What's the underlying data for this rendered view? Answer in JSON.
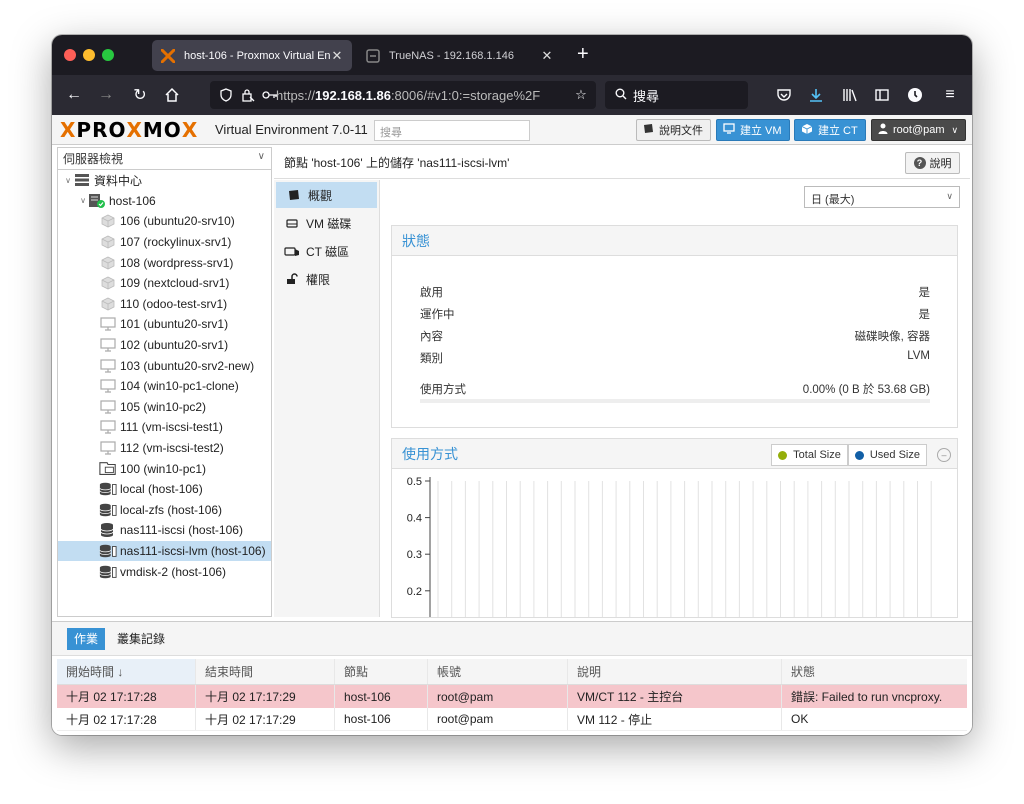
{
  "browser": {
    "tabs": [
      {
        "title": "host-106 - Proxmox Virtual Envi",
        "active": true
      },
      {
        "title": "TrueNAS - 192.168.1.146",
        "active": false
      }
    ],
    "url_prefix": "https://",
    "url_host": "192.168.1.86",
    "url_rest": ":8006/#v1:0:=storage%2F",
    "search_placeholder": "搜尋"
  },
  "header": {
    "logo_pre": "PRO",
    "logo_x": "X",
    "logo_post": "MO",
    "logo_x2": "X",
    "version": "Virtual Environment 7.0-11",
    "search_placeholder": "搜尋",
    "doc_label": "說明文件",
    "create_vm_label": "建立 VM",
    "create_ct_label": "建立 CT",
    "user_label": "root@pam"
  },
  "tree": {
    "view_label": "伺服器檢視",
    "items": [
      {
        "label": "資料中心",
        "level": 0,
        "type": "datacenter",
        "expander": "∨"
      },
      {
        "label": "host-106",
        "level": 1,
        "type": "node",
        "expander": "∨"
      },
      {
        "label": "106 (ubuntu20-srv10)",
        "level": 2,
        "type": "ct"
      },
      {
        "label": "107 (rockylinux-srv1)",
        "level": 2,
        "type": "ct"
      },
      {
        "label": "108 (wordpress-srv1)",
        "level": 2,
        "type": "ct"
      },
      {
        "label": "109 (nextcloud-srv1)",
        "level": 2,
        "type": "ct"
      },
      {
        "label": "110 (odoo-test-srv1)",
        "level": 2,
        "type": "ct"
      },
      {
        "label": "101 (ubuntu20-srv1)",
        "level": 2,
        "type": "vm"
      },
      {
        "label": "102 (ubuntu20-srv1)",
        "level": 2,
        "type": "vm"
      },
      {
        "label": "103 (ubuntu20-srv2-new)",
        "level": 2,
        "type": "vm"
      },
      {
        "label": "104 (win10-pc1-clone)",
        "level": 2,
        "type": "vm"
      },
      {
        "label": "105 (win10-pc2)",
        "level": 2,
        "type": "vm"
      },
      {
        "label": "111 (vm-iscsi-test1)",
        "level": 2,
        "type": "vm"
      },
      {
        "label": "112 (vm-iscsi-test2)",
        "level": 2,
        "type": "vm"
      },
      {
        "label": "100 (win10-pc1)",
        "level": 2,
        "type": "template"
      },
      {
        "label": "local (host-106)",
        "level": 2,
        "type": "storage"
      },
      {
        "label": "local-zfs (host-106)",
        "level": 2,
        "type": "storage"
      },
      {
        "label": "nas111-iscsi (host-106)",
        "level": 2,
        "type": "storage-plain"
      },
      {
        "label": "nas111-iscsi-lvm (host-106)",
        "level": 2,
        "type": "storage",
        "selected": true
      },
      {
        "label": "vmdisk-2 (host-106)",
        "level": 2,
        "type": "storage"
      }
    ]
  },
  "content": {
    "title": "節點 'host-106' 上的儲存 'nas111-iscsi-lvm'",
    "help_label": "說明",
    "subnav": [
      {
        "label": "概觀",
        "icon": "book-icon",
        "active": true
      },
      {
        "label": "VM 磁碟",
        "icon": "hdd-icon"
      },
      {
        "label": "CT 磁區",
        "icon": "ct-volume-icon"
      },
      {
        "label": "權限",
        "icon": "unlock-icon"
      }
    ],
    "timeframe": "日 (最大)",
    "status": {
      "title": "狀態",
      "rows": [
        {
          "key": "啟用",
          "value": "是"
        },
        {
          "key": "運作中",
          "value": "是"
        },
        {
          "key": "內容",
          "value": "磁碟映像, 容器"
        },
        {
          "key": "類別",
          "value": "LVM"
        }
      ],
      "usage_key": "使用方式",
      "usage_value": "0.00% (0 B 於 53.68 GB)",
      "usage_fraction": 0.0
    },
    "usage_chart": {
      "title": "使用方式",
      "legend": [
        {
          "name": "Total Size",
          "color": "#94ae0a"
        },
        {
          "name": "Used Size",
          "color": "#115fa6"
        }
      ]
    }
  },
  "chart_data": {
    "type": "line",
    "title": "使用方式",
    "yticks": [
      "0.5",
      "0.4",
      "0.3",
      "0.2"
    ],
    "ylim": [
      0.15,
      0.5
    ],
    "series": [
      {
        "name": "Total Size",
        "values": []
      },
      {
        "name": "Used Size",
        "values": []
      }
    ],
    "grid": true,
    "legend": "top-right"
  },
  "tasks": {
    "tabs": [
      {
        "label": "作業",
        "active": true
      },
      {
        "label": "叢集記錄",
        "active": false
      }
    ],
    "columns": [
      "開始時間 ↓",
      "結束時間",
      "節點",
      "帳號",
      "說明",
      "狀態"
    ],
    "rows": [
      {
        "start": "十月 02 17:17:28",
        "end": "十月 02 17:17:29",
        "node": "host-106",
        "user": "root@pam",
        "desc": "VM/CT 112 - 主控台",
        "status": "錯誤: Failed to run vncproxy.",
        "error": true
      },
      {
        "start": "十月 02 17:17:28",
        "end": "十月 02 17:17:29",
        "node": "host-106",
        "user": "root@pam",
        "desc": "VM 112 - 停止",
        "status": "OK",
        "error": false
      }
    ]
  }
}
